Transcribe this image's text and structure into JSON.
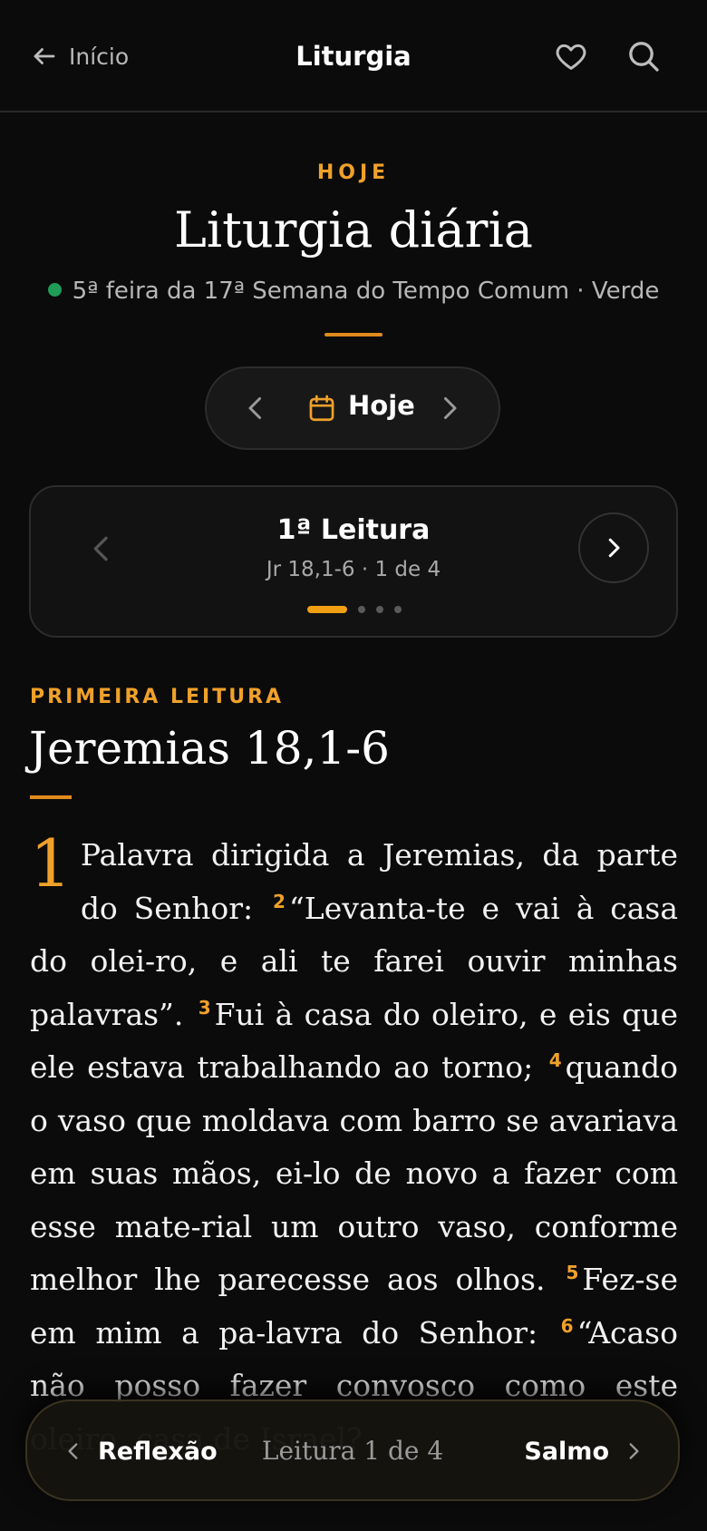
{
  "topbar": {
    "back_label": "Início",
    "title": "Liturgia"
  },
  "header": {
    "eyebrow": "HOJE",
    "title": "Liturgia diária",
    "meta": "5ª feira da 17ª Semana do Tempo Comum · Verde",
    "season_color": "#1f9d58"
  },
  "date_nav": {
    "label": "Hoje"
  },
  "reading_card": {
    "title": "1ª Leitura",
    "subtitle": "Jr 18,1-6 · 1 de 4",
    "active_index": 1,
    "total": 4
  },
  "reading": {
    "eyebrow": "PRIMEIRA LEITURA",
    "title": "Jeremias 18,1-6",
    "verses": [
      {
        "n": "1",
        "text": "Palavra dirigida a Jeremias, da parte do Senhor:"
      },
      {
        "n": "2",
        "text": "“Levanta-te e vai à casa do olei-ro, e ali te farei ouvir minhas palavras”."
      },
      {
        "n": "3",
        "text": "Fui à casa do oleiro, e eis que ele estava trabalhando ao torno;"
      },
      {
        "n": "4",
        "text": "quando o vaso que moldava com barro se avariava em suas mãos, ei-lo de novo a fazer com esse mate-rial um outro vaso, conforme melhor lhe parecesse aos olhos."
      },
      {
        "n": "5",
        "text": "Fez-se em mim a pa-lavra do Senhor:"
      },
      {
        "n": "6",
        "text": "“Acaso não posso fazer convosco como este oleiro, casa de Israel?"
      }
    ]
  },
  "bottom_nav": {
    "prev_label": "Reflexão",
    "position_label": "Leitura 1 de 4",
    "next_label": "Salmo"
  },
  "colors": {
    "accent": "#f0a12a",
    "background": "#0b0b0b"
  }
}
